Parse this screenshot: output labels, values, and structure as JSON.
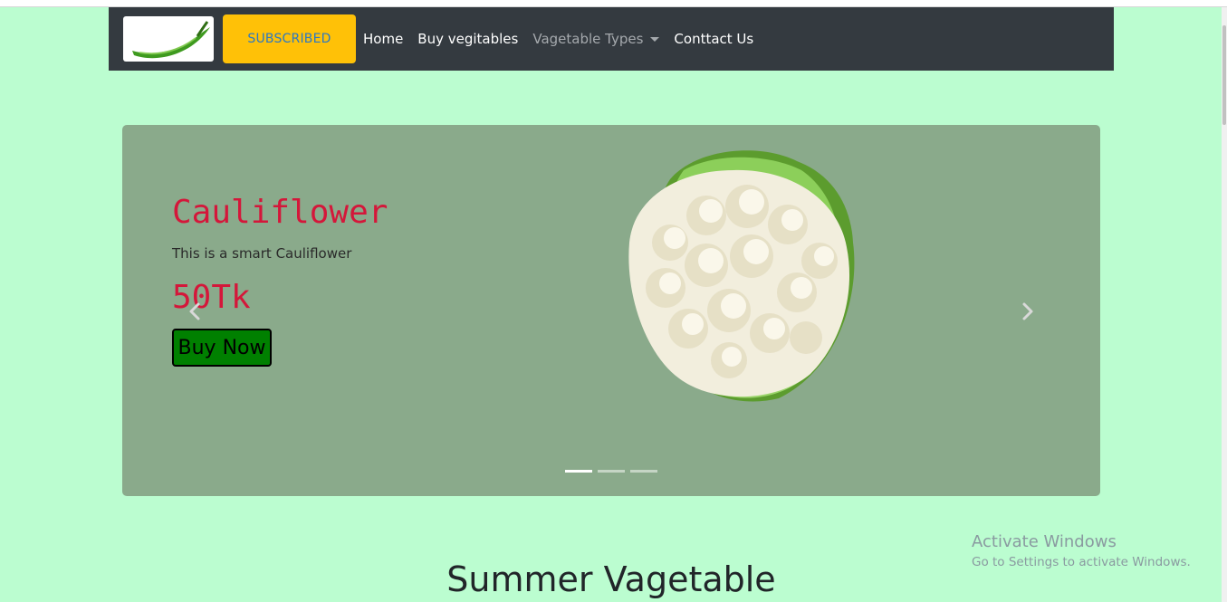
{
  "navbar": {
    "logo_icon": "green-chili-logo",
    "subscribe_label": "SUBSCRIBED",
    "links": [
      "Home",
      "Buy vegitables",
      "Vagetable Types",
      "Conttact Us"
    ],
    "colors": {
      "background": "#343a40",
      "button": "#ffc107"
    }
  },
  "carousel": {
    "title": "Cauliflower",
    "description": "This is a smart Cauliflower",
    "price": "50Tk",
    "buy_label": "Buy Now",
    "image_icon": "cauliflower-image",
    "slide_count": 3,
    "active_slide": 1,
    "colors": {
      "background": "#8aaa8b",
      "accent": "#d4173a",
      "buy_button": "#008000"
    }
  },
  "watermark": {
    "title": "Activate Windows",
    "subtitle": "Go to Settings to activate Windows."
  },
  "section": {
    "title": "Summer Vagetable"
  },
  "page": {
    "background": "#bbfdd0"
  }
}
